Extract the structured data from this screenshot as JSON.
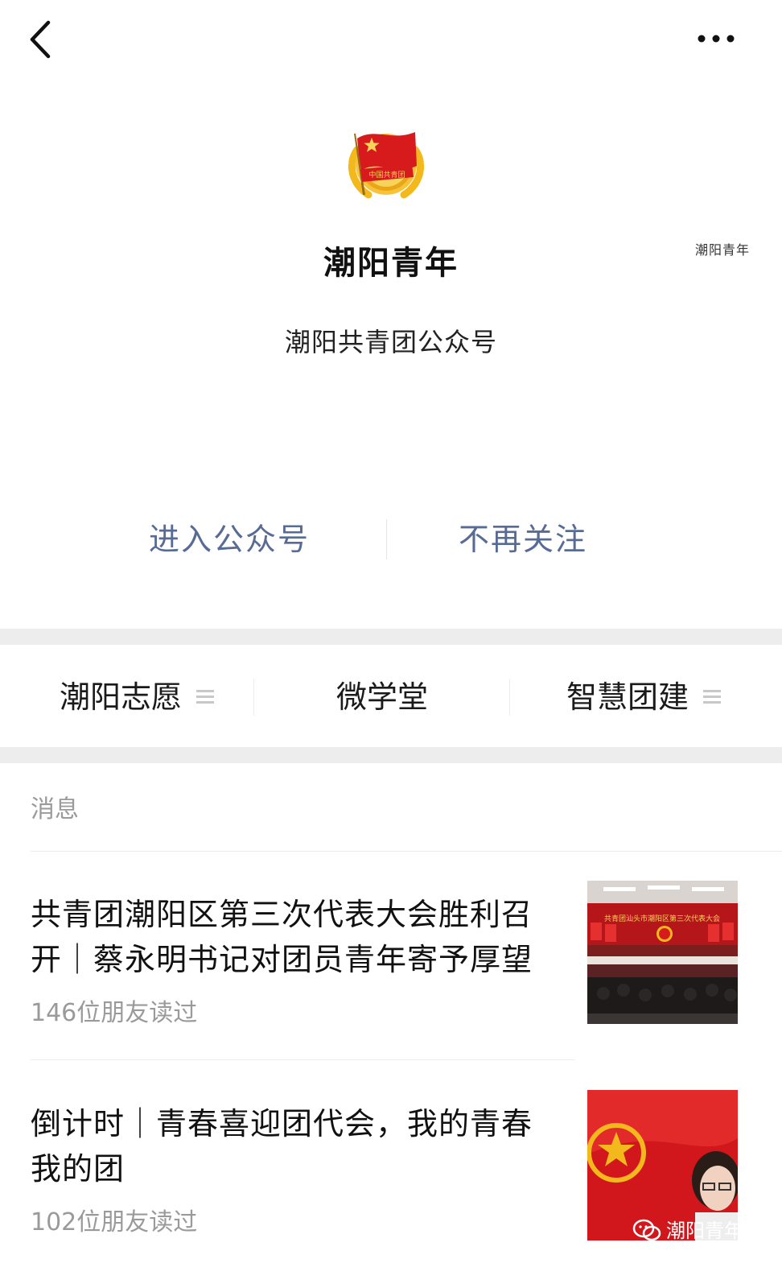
{
  "topbar": {
    "back_icon": "chevron-left-icon",
    "more_icon": "ellipsis-icon"
  },
  "profile": {
    "logo_caption": "潮阳青年",
    "name": "潮阳青年",
    "description": "潮阳共青团公众号",
    "enter_label": "进入公众号",
    "unfollow_label": "不再关注"
  },
  "menu": {
    "items": [
      {
        "label": "潮阳志愿",
        "icon": "list-icon"
      },
      {
        "label": "微学堂"
      },
      {
        "label": "智慧团建",
        "icon": "list-icon"
      }
    ]
  },
  "messages": {
    "header": "消息",
    "articles": [
      {
        "title": "共青团潮阳区第三次代表大会胜利召开｜蔡永明书记对团员青年寄予厚望",
        "readers": "146位朋友读过",
        "thumb_banner": "共青团汕头市潮阳区第三次代表大会"
      },
      {
        "title": "倒计时｜青春喜迎团代会，我的青春我的团",
        "readers": "102位朋友读过"
      }
    ]
  },
  "watermark": {
    "text": "潮阳青年"
  },
  "colors": {
    "link": "#576b95",
    "separator": "#ededed",
    "secondary_text": "#9a9a9a",
    "party_red": "#d71a1b",
    "emblem_gold": "#f2b81c"
  }
}
